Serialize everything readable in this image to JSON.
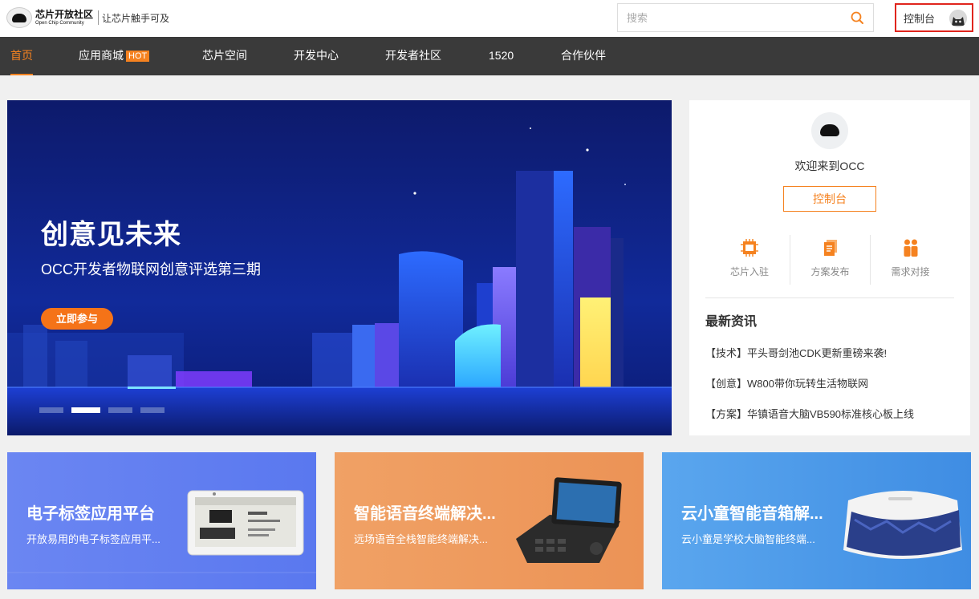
{
  "header": {
    "logo_cn": "芯片开放社区",
    "logo_en": "Open Chip Community",
    "slogan": "让芯片触手可及",
    "search_placeholder": "搜索",
    "console_label": "控制台"
  },
  "nav": {
    "items": [
      {
        "label": "首页"
      },
      {
        "label": "应用商城",
        "badge": "HOT"
      },
      {
        "label": "芯片空间"
      },
      {
        "label": "开发中心"
      },
      {
        "label": "开发者社区"
      },
      {
        "label": "1520"
      },
      {
        "label": "合作伙伴"
      }
    ]
  },
  "banner": {
    "title": "创意见未来",
    "subtitle": "OCC开发者物联网创意评选第三期",
    "button": "立即参与",
    "slide_count": 4,
    "active_slide": 2
  },
  "side": {
    "welcome": "欢迎来到OCC",
    "console_button": "控制台",
    "quick_links": [
      {
        "label": "芯片入驻",
        "icon": "chip-icon"
      },
      {
        "label": "方案发布",
        "icon": "document-icon"
      },
      {
        "label": "需求对接",
        "icon": "people-icon"
      }
    ],
    "news_title": "最新资讯",
    "news": [
      "【技术】平头哥剑池CDK更新重磅来袭!",
      "【创意】W800带你玩转生活物联网",
      "【方案】华镇语音大脑VB590标准核心板上线"
    ]
  },
  "cards": [
    {
      "title": "电子标签应用平台",
      "desc": "开放易用的电子标签应用平..."
    },
    {
      "title": "智能语音终端解决...",
      "desc": "远场语音全栈智能终端解决..."
    },
    {
      "title": "云小童智能音箱解...",
      "desc": "云小童是学校大脑智能终端..."
    }
  ],
  "colors": {
    "accent": "#f58220",
    "nav_bg": "#3a3a3a",
    "highlight_border": "#e0251d",
    "card1": "#6b86f2",
    "card2": "#ef9b5c",
    "card3": "#4b99e8"
  }
}
